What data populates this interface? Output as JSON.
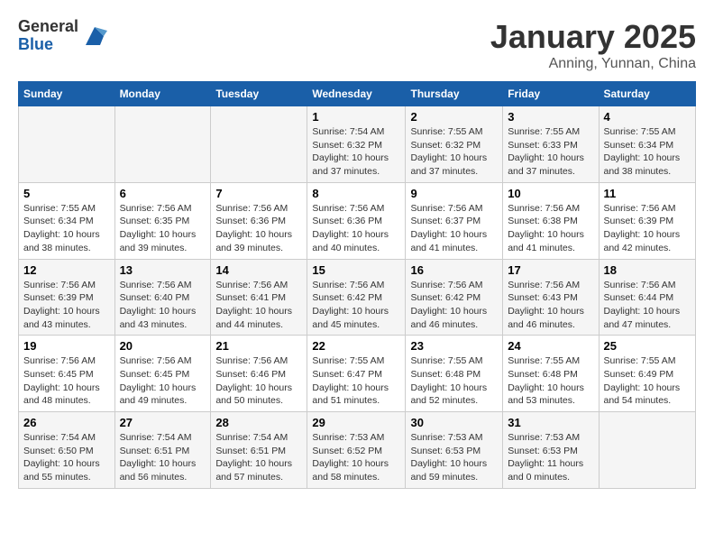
{
  "logo": {
    "general": "General",
    "blue": "Blue"
  },
  "header": {
    "month": "January 2025",
    "location": "Anning, Yunnan, China"
  },
  "weekdays": [
    "Sunday",
    "Monday",
    "Tuesday",
    "Wednesday",
    "Thursday",
    "Friday",
    "Saturday"
  ],
  "weeks": [
    [
      {
        "day": "",
        "info": ""
      },
      {
        "day": "",
        "info": ""
      },
      {
        "day": "",
        "info": ""
      },
      {
        "day": "1",
        "sunrise": "7:54 AM",
        "sunset": "6:32 PM",
        "daylight": "10 hours and 37 minutes."
      },
      {
        "day": "2",
        "sunrise": "7:55 AM",
        "sunset": "6:32 PM",
        "daylight": "10 hours and 37 minutes."
      },
      {
        "day": "3",
        "sunrise": "7:55 AM",
        "sunset": "6:33 PM",
        "daylight": "10 hours and 37 minutes."
      },
      {
        "day": "4",
        "sunrise": "7:55 AM",
        "sunset": "6:34 PM",
        "daylight": "10 hours and 38 minutes."
      }
    ],
    [
      {
        "day": "5",
        "sunrise": "7:55 AM",
        "sunset": "6:34 PM",
        "daylight": "10 hours and 38 minutes."
      },
      {
        "day": "6",
        "sunrise": "7:56 AM",
        "sunset": "6:35 PM",
        "daylight": "10 hours and 39 minutes."
      },
      {
        "day": "7",
        "sunrise": "7:56 AM",
        "sunset": "6:36 PM",
        "daylight": "10 hours and 39 minutes."
      },
      {
        "day": "8",
        "sunrise": "7:56 AM",
        "sunset": "6:36 PM",
        "daylight": "10 hours and 40 minutes."
      },
      {
        "day": "9",
        "sunrise": "7:56 AM",
        "sunset": "6:37 PM",
        "daylight": "10 hours and 41 minutes."
      },
      {
        "day": "10",
        "sunrise": "7:56 AM",
        "sunset": "6:38 PM",
        "daylight": "10 hours and 41 minutes."
      },
      {
        "day": "11",
        "sunrise": "7:56 AM",
        "sunset": "6:39 PM",
        "daylight": "10 hours and 42 minutes."
      }
    ],
    [
      {
        "day": "12",
        "sunrise": "7:56 AM",
        "sunset": "6:39 PM",
        "daylight": "10 hours and 43 minutes."
      },
      {
        "day": "13",
        "sunrise": "7:56 AM",
        "sunset": "6:40 PM",
        "daylight": "10 hours and 43 minutes."
      },
      {
        "day": "14",
        "sunrise": "7:56 AM",
        "sunset": "6:41 PM",
        "daylight": "10 hours and 44 minutes."
      },
      {
        "day": "15",
        "sunrise": "7:56 AM",
        "sunset": "6:42 PM",
        "daylight": "10 hours and 45 minutes."
      },
      {
        "day": "16",
        "sunrise": "7:56 AM",
        "sunset": "6:42 PM",
        "daylight": "10 hours and 46 minutes."
      },
      {
        "day": "17",
        "sunrise": "7:56 AM",
        "sunset": "6:43 PM",
        "daylight": "10 hours and 46 minutes."
      },
      {
        "day": "18",
        "sunrise": "7:56 AM",
        "sunset": "6:44 PM",
        "daylight": "10 hours and 47 minutes."
      }
    ],
    [
      {
        "day": "19",
        "sunrise": "7:56 AM",
        "sunset": "6:45 PM",
        "daylight": "10 hours and 48 minutes."
      },
      {
        "day": "20",
        "sunrise": "7:56 AM",
        "sunset": "6:45 PM",
        "daylight": "10 hours and 49 minutes."
      },
      {
        "day": "21",
        "sunrise": "7:56 AM",
        "sunset": "6:46 PM",
        "daylight": "10 hours and 50 minutes."
      },
      {
        "day": "22",
        "sunrise": "7:55 AM",
        "sunset": "6:47 PM",
        "daylight": "10 hours and 51 minutes."
      },
      {
        "day": "23",
        "sunrise": "7:55 AM",
        "sunset": "6:48 PM",
        "daylight": "10 hours and 52 minutes."
      },
      {
        "day": "24",
        "sunrise": "7:55 AM",
        "sunset": "6:48 PM",
        "daylight": "10 hours and 53 minutes."
      },
      {
        "day": "25",
        "sunrise": "7:55 AM",
        "sunset": "6:49 PM",
        "daylight": "10 hours and 54 minutes."
      }
    ],
    [
      {
        "day": "26",
        "sunrise": "7:54 AM",
        "sunset": "6:50 PM",
        "daylight": "10 hours and 55 minutes."
      },
      {
        "day": "27",
        "sunrise": "7:54 AM",
        "sunset": "6:51 PM",
        "daylight": "10 hours and 56 minutes."
      },
      {
        "day": "28",
        "sunrise": "7:54 AM",
        "sunset": "6:51 PM",
        "daylight": "10 hours and 57 minutes."
      },
      {
        "day": "29",
        "sunrise": "7:53 AM",
        "sunset": "6:52 PM",
        "daylight": "10 hours and 58 minutes."
      },
      {
        "day": "30",
        "sunrise": "7:53 AM",
        "sunset": "6:53 PM",
        "daylight": "10 hours and 59 minutes."
      },
      {
        "day": "31",
        "sunrise": "7:53 AM",
        "sunset": "6:53 PM",
        "daylight": "11 hours and 0 minutes."
      },
      {
        "day": "",
        "info": ""
      }
    ]
  ],
  "labels": {
    "sunrise": "Sunrise:",
    "sunset": "Sunset:",
    "daylight": "Daylight:"
  }
}
